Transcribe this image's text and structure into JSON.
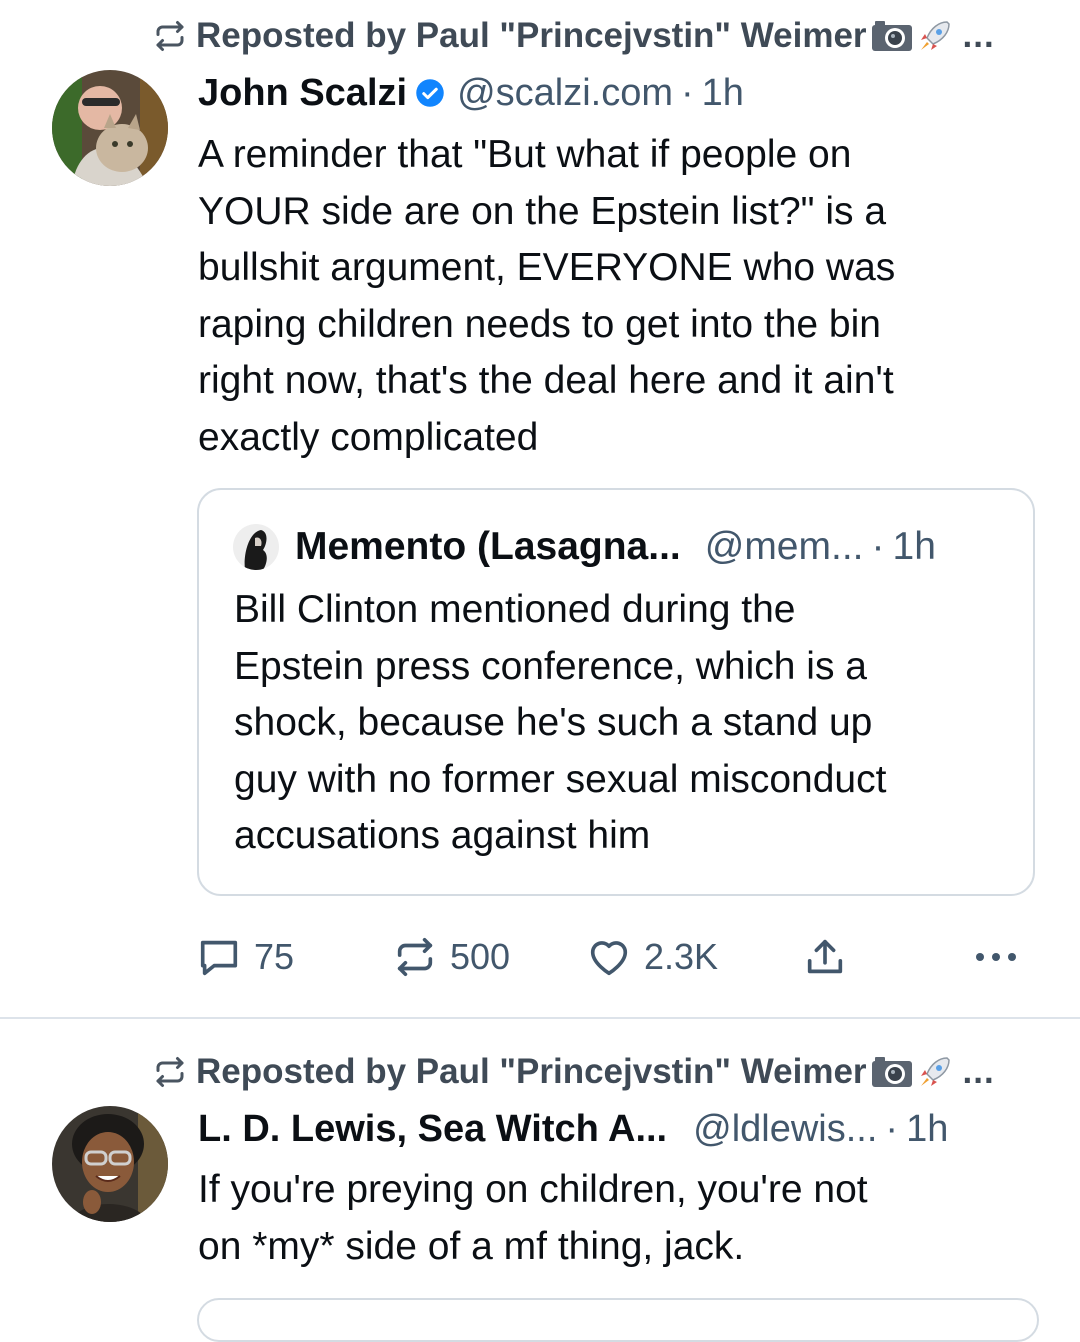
{
  "feed": {
    "posts": [
      {
        "repost": {
          "prefix": "Reposted by",
          "by": "Paul \"Princejvstin\" Weimer",
          "emoji": [
            "camera",
            "rocket"
          ],
          "more": "..."
        },
        "author": {
          "name": "John Scalzi",
          "verified": true,
          "handle": "@scalzi.com",
          "time": "1h"
        },
        "text": [
          "A reminder that \"But what if people on",
          "YOUR side are on the Epstein list?\" is a",
          "bullshit argument, EVERYONE who was",
          "raping children needs to get into the bin",
          "right now, that's the deal here and it ain't",
          "exactly complicated"
        ],
        "quote": {
          "author": {
            "name": "Memento (Lasagna...",
            "handle": "@mem...",
            "time": "1h"
          },
          "text": [
            "Bill Clinton mentioned during the",
            "Epstein press conference, which is a",
            "shock, because he's such a stand up",
            "guy with no former sexual misconduct",
            "accusations against him"
          ]
        },
        "actions": {
          "replies": "75",
          "reposts": "500",
          "likes": "2.3K"
        }
      },
      {
        "repost": {
          "prefix": "Reposted by",
          "by": "Paul \"Princejvstin\" Weimer",
          "emoji": [
            "camera",
            "rocket"
          ],
          "more": "..."
        },
        "author": {
          "name": "L. D. Lewis, Sea Witch A...",
          "handle": "@ldlewis...",
          "time": "1h"
        },
        "text": [
          "If you're preying on children, you're not",
          "on *my* side of a mf thing, jack."
        ]
      }
    ],
    "separator": "·",
    "colors": {
      "text": "#0b0f14",
      "muted": "#42576c",
      "repost": "#3f4a56",
      "verified": "#1185fe",
      "border": "#d4dbe2"
    }
  }
}
